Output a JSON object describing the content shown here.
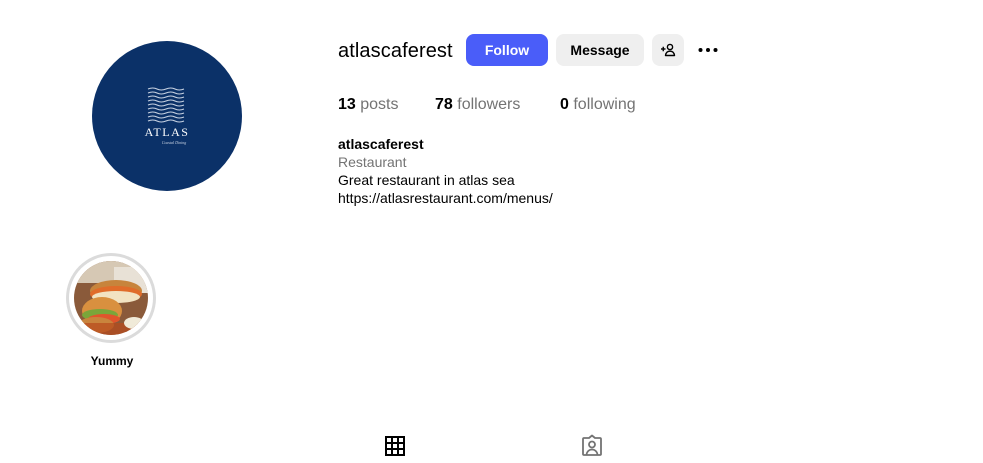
{
  "profile": {
    "username": "atlascaferest",
    "avatar_brand": "ATLAS",
    "avatar_tagline": "Coastal Dining",
    "brand_color": "#0b3168"
  },
  "actions": {
    "follow_label": "Follow",
    "message_label": "Message",
    "suggest_icon": "person-plus-icon",
    "more_icon": "more-horizontal-icon",
    "accent_color": "#4a5df9"
  },
  "stats": {
    "posts_count": "13",
    "posts_label": "posts",
    "followers_count": "78",
    "followers_label": "followers",
    "following_count": "0",
    "following_label": "following"
  },
  "bio": {
    "name": "atlascaferest",
    "category": "Restaurant",
    "description": "Great restaurant in atlas sea",
    "link": "https://atlasrestaurant.com/menus/"
  },
  "highlights": [
    {
      "label": "Yummy",
      "thumbnail": "sandwich-photo"
    }
  ],
  "tabs": [
    {
      "name": "posts",
      "icon": "grid-icon",
      "active": true
    },
    {
      "name": "tagged",
      "icon": "tagged-user-icon",
      "active": false
    }
  ]
}
